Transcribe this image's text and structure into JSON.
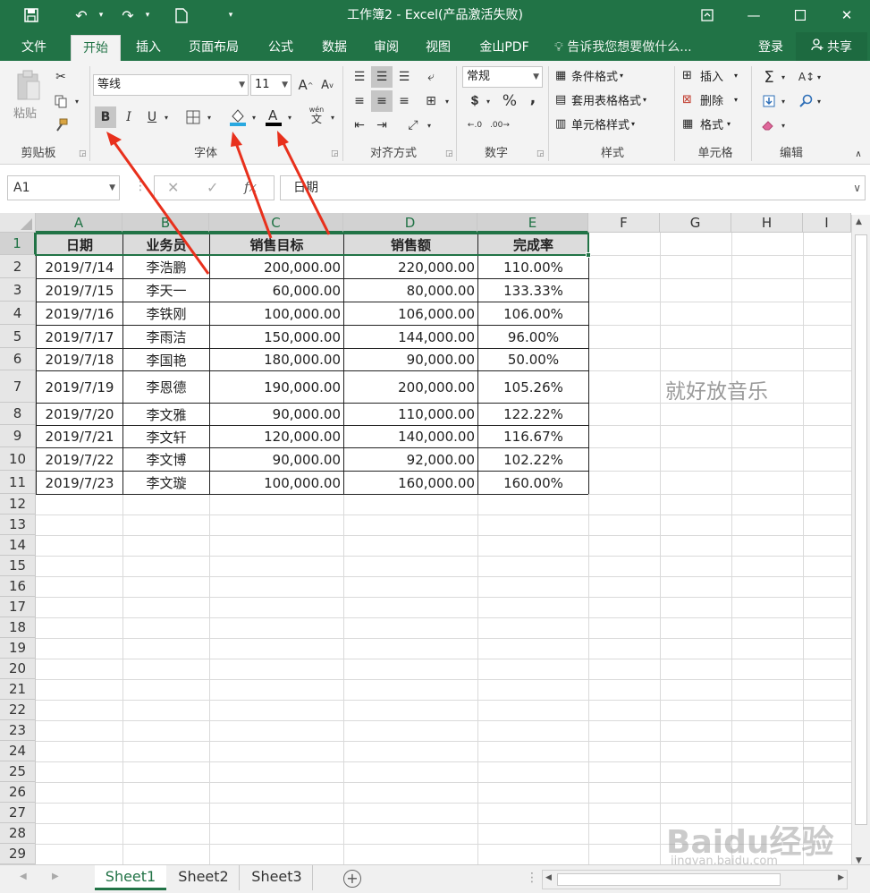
{
  "titlebar": {
    "title": "工作簿2 - Excel(产品激活失败)",
    "save_icon": "save-icon",
    "quick_icons": [
      "undo-icon",
      "redo-icon",
      "new-file-icon",
      "customize-icon"
    ],
    "controls": {
      "ribbon_options": "▣",
      "minimize": "—",
      "maximize": "☐",
      "close": "✕"
    }
  },
  "tabs": [
    "文件",
    "开始",
    "插入",
    "页面布局",
    "公式",
    "数据",
    "审阅",
    "视图",
    "金山PDF"
  ],
  "active_tab": "开始",
  "tellme": "告诉我您想要做什么...",
  "login": "登录",
  "share": "共享",
  "ribbon": {
    "clipboard": {
      "label": "剪贴板",
      "paste": "粘贴"
    },
    "font": {
      "label": "字体",
      "font_name": "等线",
      "font_size": "11",
      "grow": "A",
      "shrink": "A",
      "bold": "B",
      "italic": "I",
      "underline": "U",
      "phonetic": "wén",
      "phonetic_char": "文"
    },
    "alignment": {
      "label": "对齐方式"
    },
    "number": {
      "label": "数字",
      "format": "常规",
      "percent": "%",
      "comma": ",",
      "inc_decimal": ".00",
      "dec_decimal": ".00"
    },
    "styles": {
      "label": "样式",
      "conditional": "条件格式",
      "table": "套用表格格式",
      "cell_styles": "单元格样式"
    },
    "cells": {
      "label": "单元格",
      "insert": "插入",
      "delete": "删除",
      "format": "格式"
    },
    "editing": {
      "label": "编辑",
      "sum": "Σ"
    }
  },
  "formula_bar": {
    "name_box": "A1",
    "cancel": "✕",
    "enter": "✓",
    "fx": "fx",
    "content": "日期"
  },
  "columns": [
    "A",
    "B",
    "C",
    "D",
    "E",
    "F",
    "G",
    "H",
    "I"
  ],
  "rows": [
    "1",
    "2",
    "3",
    "4",
    "5",
    "6",
    "7",
    "8",
    "9",
    "10",
    "11",
    "12",
    "13",
    "14",
    "15",
    "16",
    "17",
    "18",
    "19",
    "20",
    "21",
    "22",
    "23",
    "24",
    "25",
    "26",
    "27",
    "28",
    "29"
  ],
  "table": {
    "headers": [
      "日期",
      "业务员",
      "销售目标",
      "销售额",
      "完成率"
    ],
    "rows": [
      [
        "2019/7/14",
        "李浩鹏",
        "200,000.00",
        "220,000.00",
        "110.00%"
      ],
      [
        "2019/7/15",
        "李天一",
        "60,000.00",
        "80,000.00",
        "133.33%"
      ],
      [
        "2019/7/16",
        "李铁刚",
        "100,000.00",
        "106,000.00",
        "106.00%"
      ],
      [
        "2019/7/17",
        "李雨洁",
        "150,000.00",
        "144,000.00",
        "96.00%"
      ],
      [
        "2019/7/18",
        "李国艳",
        "180,000.00",
        "90,000.00",
        "50.00%"
      ],
      [
        "2019/7/19",
        "李恩德",
        "190,000.00",
        "200,000.00",
        "105.26%"
      ],
      [
        "2019/7/20",
        "李文雅",
        "90,000.00",
        "110,000.00",
        "122.22%"
      ],
      [
        "2019/7/21",
        "李文轩",
        "120,000.00",
        "140,000.00",
        "116.67%"
      ],
      [
        "2019/7/22",
        "李文博",
        "90,000.00",
        "92,000.00",
        "102.22%"
      ],
      [
        "2019/7/23",
        "李文璇",
        "100,000.00",
        "160,000.00",
        "160.00%"
      ]
    ]
  },
  "floating_text": "就好放音乐",
  "watermark": {
    "brand": "Baidu经验",
    "url": "jingyan.baidu.com"
  },
  "sheets": [
    "Sheet1",
    "Sheet2",
    "Sheet3"
  ],
  "active_sheet": "Sheet1",
  "colors": {
    "excel_green": "#217346",
    "arrow_red": "#e8301c",
    "fill_color": "#29a8e0",
    "font_color": "#000000"
  }
}
